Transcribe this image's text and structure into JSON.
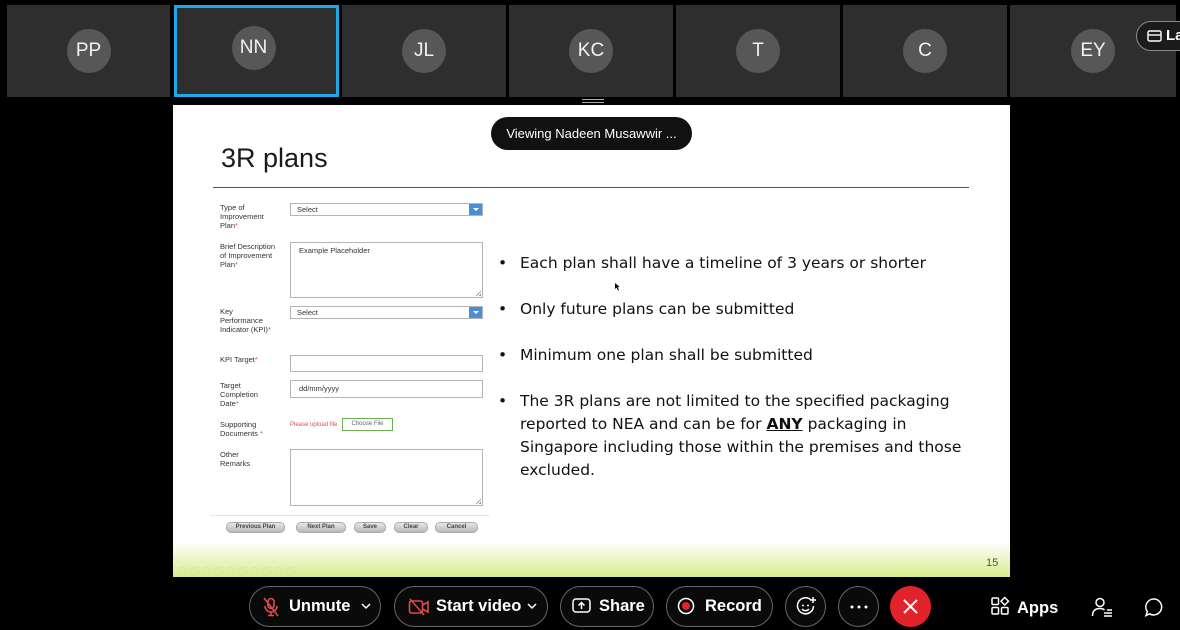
{
  "participants": [
    {
      "initials": "PP",
      "active": false
    },
    {
      "initials": "NN",
      "active": true
    },
    {
      "initials": "JL",
      "active": false
    },
    {
      "initials": "KC",
      "active": false
    },
    {
      "initials": "T",
      "active": false
    },
    {
      "initials": "C",
      "active": false
    },
    {
      "initials": "EY",
      "active": false
    }
  ],
  "layout_button": {
    "label": "La",
    "icon": "layout-icon"
  },
  "share_banner": "Viewing Nadeen Musawwir ...",
  "slide": {
    "title": "3R plans",
    "page_number": "15",
    "form": {
      "type_label": "Type of Improvement Plan",
      "type_value": "Select",
      "desc_label": "Brief Description of Improvement Plan",
      "desc_placeholder": "Example Placeholder",
      "kpi_label": "Key Performance Indicator (KPI)",
      "kpi_value": "Select",
      "kpi_target_label": "KPI Target",
      "date_label": "Target Completion Date",
      "date_placeholder": "dd/mm/yyyy",
      "docs_label": "Supporting Documents",
      "upload_error": "Please upload file",
      "choose_file": "Choose File",
      "remarks_label": "Other Remarks",
      "required_mark": "*",
      "buttons": [
        "Previous Plan",
        "Next Plan",
        "Save",
        "Clear",
        "Cancel"
      ]
    },
    "bullets": {
      "b1": "Each plan shall have a timeline of 3 years or shorter",
      "b2": "Only future plans can be submitted",
      "b3": "Minimum one plan shall be submitted",
      "b4_l1": "The 3R plans are not limited to the specified packaging",
      "b4_l2_pre": "reported to NEA and can be for ",
      "b4_l2_em": "ANY",
      "b4_l2_post": " packaging in",
      "b4_l3": "Singapore including those within the premises and those",
      "b4_l4": "excluded."
    }
  },
  "controls": {
    "unmute": "Unmute",
    "start_video": "Start video",
    "share": "Share",
    "record": "Record",
    "apps": "Apps"
  },
  "colors": {
    "active_tile_border": "#1ea8e8",
    "end_call": "#e2232a",
    "form_select_arrow": "#4a8fd4",
    "required": "#d9534f"
  }
}
